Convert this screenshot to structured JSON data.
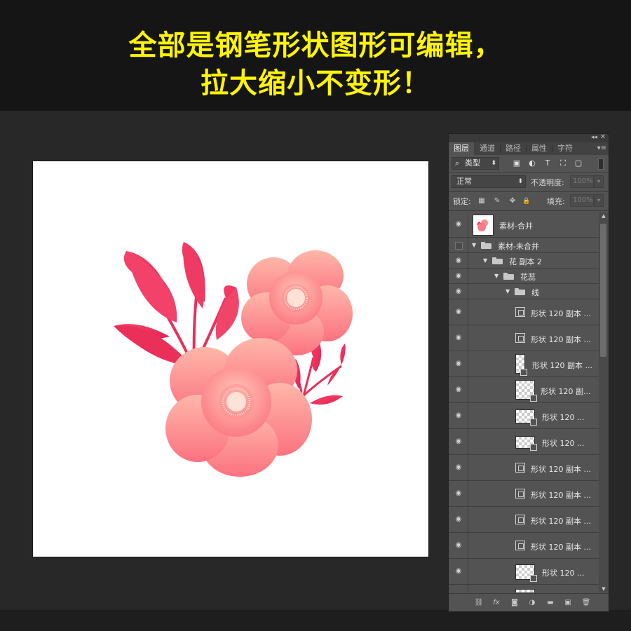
{
  "banner": {
    "line1": "全部是钢笔形状图形可编辑，",
    "line2": "拉大缩小不变形！"
  },
  "colors": {
    "banner_text": "#fff500",
    "petal_light": "#ffc2b4",
    "petal_dark": "#fb6b78",
    "leaf": "#f0345c"
  },
  "panel": {
    "collapse_icon": "◂◂",
    "close_icon": "✕",
    "tabs": [
      {
        "label": "图层",
        "active": true
      },
      {
        "label": "通道",
        "active": false
      },
      {
        "label": "路径",
        "active": false
      },
      {
        "label": "属性",
        "active": false
      },
      {
        "label": "字符",
        "active": false
      }
    ],
    "menu_icon": "▾≡",
    "filter": {
      "icon": "⌕",
      "value": "类型",
      "arrow": "⬍"
    },
    "filter_icons": [
      "image-filter-icon",
      "adjustment-filter-icon",
      "type-filter-icon",
      "shape-filter-icon",
      "smart-object-filter-icon"
    ],
    "filter_glyphs": [
      "▣",
      "◐",
      "T",
      "⛶",
      "▢"
    ],
    "blend": {
      "value": "正常",
      "arrow": "⬍"
    },
    "opacity": {
      "label": "不透明度:",
      "value": "100%"
    },
    "lock": {
      "label": "锁定:"
    },
    "lock_glyphs": [
      "▦",
      "✎",
      "✥",
      "🔒"
    ],
    "fill": {
      "label": "填充:",
      "value": "100%"
    },
    "spinner_glyph": "▾",
    "eye_glyph": "◉",
    "expand_glyph": "▼",
    "scroll_up": "▲",
    "scroll_down": "▼",
    "layers": [
      {
        "name": "素材-合并",
        "type": "flower",
        "visible": true,
        "indent": 0
      },
      {
        "name": "素材-未合并",
        "type": "group",
        "visible": false,
        "indent": 0
      },
      {
        "name": "花 副本 2",
        "type": "group",
        "visible": true,
        "indent": 1
      },
      {
        "name": "花蕊",
        "type": "group",
        "visible": true,
        "indent": 2
      },
      {
        "name": "线",
        "type": "group",
        "visible": true,
        "indent": 3
      },
      {
        "name": "形状 120 副本 ...",
        "type": "shape",
        "visible": true
      },
      {
        "name": "形状 120 副本 ...",
        "type": "shape",
        "visible": true
      },
      {
        "name": "形状 120 副本 ...",
        "type": "checker-tall",
        "visible": true
      },
      {
        "name": "形状 120 副...",
        "type": "checker-full",
        "visible": true
      },
      {
        "name": "形状 120 ...",
        "type": "checker-wide",
        "visible": true
      },
      {
        "name": "形状 120 ...",
        "type": "checker-wide",
        "visible": true
      },
      {
        "name": "形状 120 副本 ...",
        "type": "shape",
        "visible": true
      },
      {
        "name": "形状 120 副本 ...",
        "type": "shape",
        "visible": true
      },
      {
        "name": "形状 120 副本 ...",
        "type": "shape",
        "visible": true
      },
      {
        "name": "形状 120 副本 ...",
        "type": "shape",
        "visible": true
      },
      {
        "name": "形状 120 ...",
        "type": "checker-wide",
        "visible": true
      }
    ],
    "footer_icons": [
      "link-layers-icon",
      "fx-icon",
      "mask-icon",
      "adjustment-layer-icon",
      "new-group-icon",
      "new-layer-icon",
      "delete-layer-icon"
    ],
    "footer_glyphs": [
      "⛓",
      "fx",
      "◙",
      "◑",
      "▬",
      "▣",
      "🗑"
    ]
  }
}
